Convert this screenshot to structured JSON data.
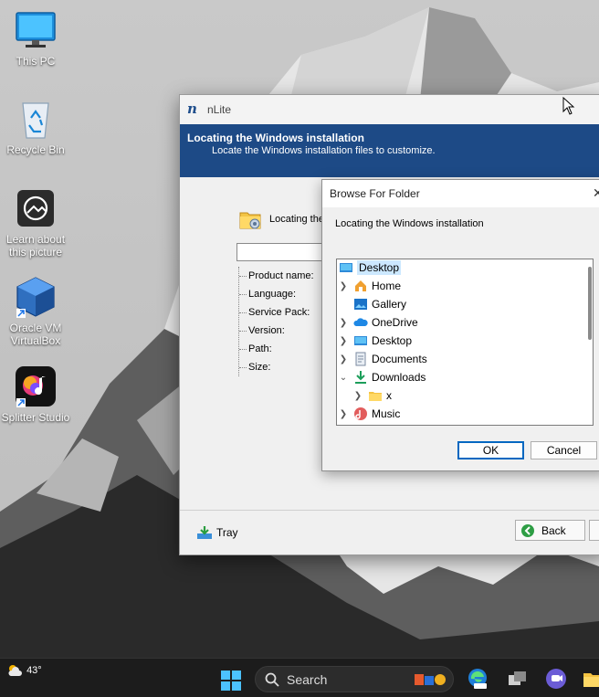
{
  "desktop": {
    "icons": [
      {
        "label": "This PC",
        "icon": "monitor-icon"
      },
      {
        "label": "Recycle Bin",
        "icon": "recycle-bin-icon"
      },
      {
        "label": "Learn about this picture",
        "icon": "camera-icon"
      },
      {
        "label": "Oracle VM VirtualBox",
        "icon": "virtualbox-icon"
      },
      {
        "label": "Splitter Studio",
        "icon": "splitter-studio-icon"
      }
    ]
  },
  "nlite": {
    "title": "nLite",
    "banner_title": "Locating the Windows installation",
    "banner_subtitle": "Locate the Windows installation files to customize.",
    "locating_label": "Locating the",
    "info_fields": [
      "Product name:",
      "Language:",
      "Service Pack:",
      "Version:",
      "Path:",
      "Size:"
    ],
    "tray_label": "Tray",
    "back_label": "Back",
    "colors": {
      "banner": "#1d4a86"
    }
  },
  "browse_dialog": {
    "title": "Browse For Folder",
    "description": "Locating the Windows installation",
    "tree": [
      {
        "label": "Desktop",
        "icon": "desktop-folder-icon",
        "selected": true
      },
      {
        "label": "Home",
        "icon": "home-icon"
      },
      {
        "label": "Gallery",
        "icon": "gallery-icon"
      },
      {
        "label": "OneDrive",
        "icon": "cloud-icon"
      },
      {
        "label": "Desktop",
        "icon": "desktop-folder-icon"
      },
      {
        "label": "Documents",
        "icon": "documents-icon"
      },
      {
        "label": "Downloads",
        "icon": "download-icon"
      },
      {
        "label": "x",
        "icon": "folder-icon"
      },
      {
        "label": "Music",
        "icon": "music-icon"
      }
    ],
    "ok_label": "OK",
    "cancel_label": "Cancel"
  },
  "taskbar": {
    "weather_temp": "43°",
    "search_label": "Search"
  }
}
